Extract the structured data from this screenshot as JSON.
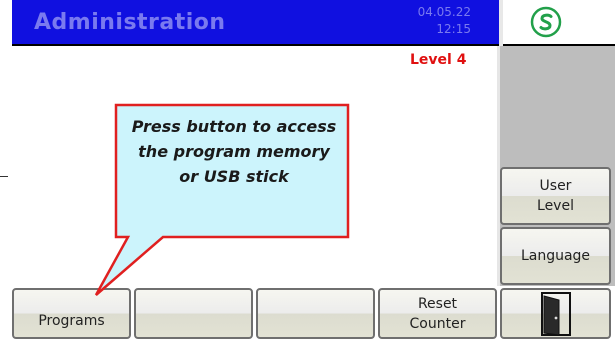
{
  "header": {
    "title": "Administration",
    "date": "04.05.22",
    "time": "12:15",
    "logo_icon": "brand-s-icon"
  },
  "level_label": "Level 4",
  "callout": {
    "text_line1": "Press button to access",
    "text_line2": "the program memory",
    "text_line3": "or USB stick"
  },
  "side_buttons": {
    "user_level_line1": "User",
    "user_level_line2": "Level",
    "language": "Language"
  },
  "bottom_buttons": {
    "programs": "Programs",
    "empty_1": "",
    "empty_2": "",
    "reset_line1": "Reset",
    "reset_line2": "Counter",
    "exit_icon": "door-exit-icon"
  },
  "colors": {
    "header_bg": "#1010e0",
    "header_text": "#7a7aef",
    "level_text": "#e01010",
    "callout_fill": "#ccf4fc",
    "callout_border": "#e02020",
    "logo_green": "#22a04a"
  }
}
